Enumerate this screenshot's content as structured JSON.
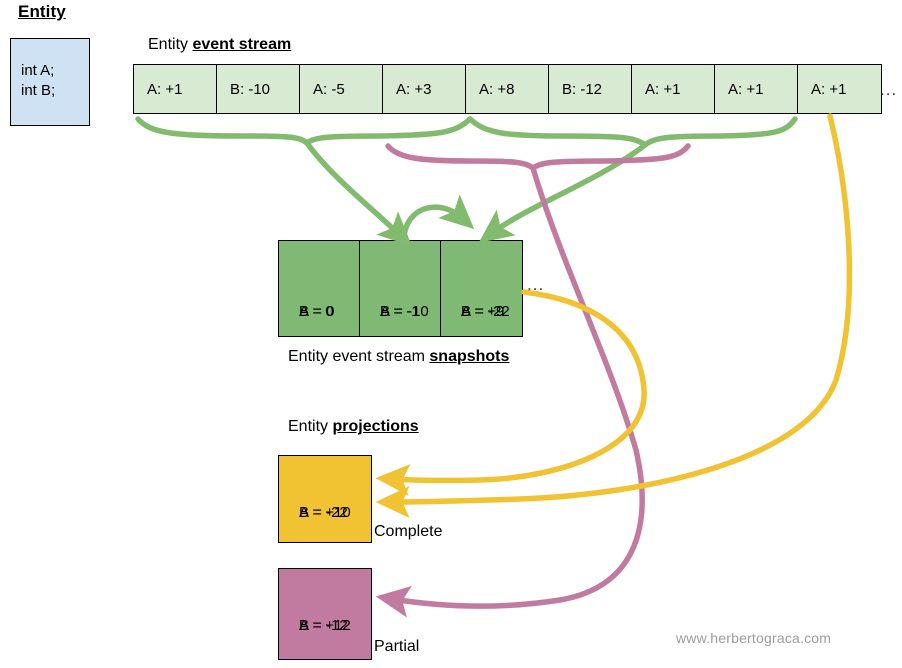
{
  "diagram": {
    "title": "Entity",
    "watermark": "www.herbertograca.com",
    "colors": {
      "entity_box_fill": "#cfe2f3",
      "event_cell_fill": "#d9ead3",
      "snapshot_fill": "#7fb973",
      "complete_projection_fill": "#f1c232",
      "partial_projection_fill": "#c27ba0",
      "green_arrow": "#82bb6e",
      "pink_arrow": "#c27ba0",
      "yellow_arrow": "#f1c232"
    }
  },
  "entity": {
    "heading": "Entity",
    "fields_line1": "int A;",
    "fields_line2": "int B;"
  },
  "event_stream": {
    "label_prefix": "Entity ",
    "label_emphasis": "event stream",
    "ellipsis": "...",
    "events": [
      "A: +1",
      "B: -10",
      "A: -5",
      "A: +3",
      "A: +8",
      "B: -12",
      "A: +1",
      "A: +1",
      "A: +1"
    ]
  },
  "snapshots": {
    "label_prefix": "Entity event stream ",
    "label_emphasis": "snapshots",
    "ellipsis": "...",
    "items": [
      {
        "a": "A = 0",
        "b": "B = 0"
      },
      {
        "a": "A = -1",
        "b": "B = -10"
      },
      {
        "a": "A = +9",
        "b": "B = -22"
      }
    ]
  },
  "projections": {
    "label_prefix": "Entity ",
    "label_emphasis": "projections",
    "complete": {
      "a": "A = +10",
      "b": "B = -22",
      "caption": "Complete"
    },
    "partial": {
      "a": "A = +12",
      "b": "B = -12",
      "caption": "Partial"
    }
  }
}
